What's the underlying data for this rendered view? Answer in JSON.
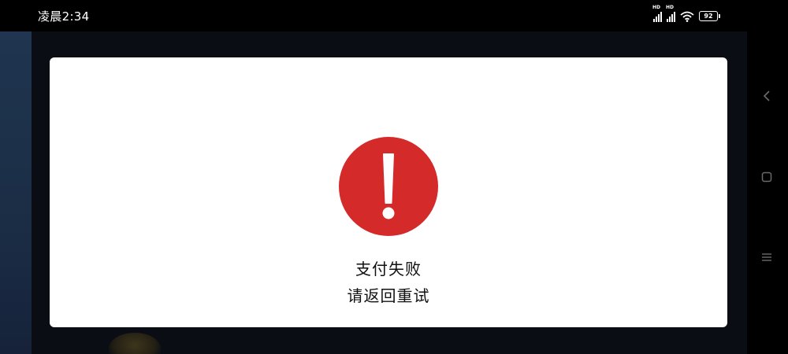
{
  "status_bar": {
    "time": "凌晨2:34",
    "battery_level": "92",
    "signal_label": "HD"
  },
  "dialog": {
    "icon": "error-exclamation-icon",
    "title": "支付失败",
    "subtitle": "请返回重试",
    "accent_color": "#d42a2a"
  },
  "nav_bar": {
    "buttons": [
      "back",
      "home",
      "menu"
    ]
  }
}
